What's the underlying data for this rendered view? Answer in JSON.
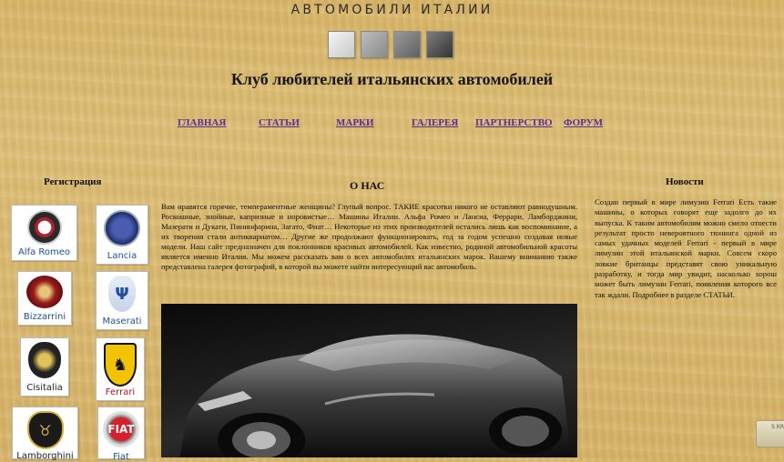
{
  "header": {
    "site_title": "АВТОМОБИЛИ ИТАЛИИ",
    "club_heading": "Клуб любителей итальянских автомобилей"
  },
  "nav": {
    "items": [
      {
        "label": "ГЛАВНАЯ"
      },
      {
        "label": "СТАТЬИ"
      },
      {
        "label": "МАРКИ"
      },
      {
        "label": "ГАЛЕРЕЯ"
      },
      {
        "label": "ПАРТНЕРСТВО"
      },
      {
        "label": "ФОРУМ"
      }
    ],
    "link_color": "#5a2d91"
  },
  "left": {
    "title": "Регистрация",
    "logos": [
      {
        "name": "Alfa Romeo",
        "icon": "alfa-romeo-icon",
        "color": "#b41e2a"
      },
      {
        "name": "Lancia",
        "icon": "lancia-icon",
        "color": "#2a3d8f"
      },
      {
        "name": "Bizzarrini",
        "icon": "bizzarrini-icon",
        "color": "#9b1b1b"
      },
      {
        "name": "Maserati",
        "icon": "maserati-icon",
        "color": "#1e4fa0"
      },
      {
        "name": "Cisitalia",
        "icon": "cisitalia-icon",
        "color": "#222222"
      },
      {
        "name": "Ferrari",
        "icon": "ferrari-icon",
        "color": "#f3c300"
      },
      {
        "name": "Lamborghini",
        "icon": "lamborghini-icon",
        "color": "#1a1a1a"
      },
      {
        "name": "Fiat",
        "icon": "fiat-icon",
        "color": "#b8121b"
      }
    ]
  },
  "center": {
    "title": "О НАС",
    "text": "Вам нравятся горячие, темпераментные женщины? Глупый вопрос. ТАКИЕ красотки никого не оставляют равнодушным. Роскошные, знойные, капризные и норовистые… Машины Италии. Альфа Ромео и Лансиа, Феррари, Ламборджини, Мазерати и Дукати, Пининфарина, Загато, Фиат… Некоторые из этих производителей остались лишь как воспоминание, а их творения стали антиквариатом… Другие же продолжают функционировать, год за годом успешно создавая новые модели. Наш сайт предназначен для поклонников красивых автомобилей. Как известно, родиной автомобильной красоты является именно Италия. Мы можем рассказать вам о всех автомобилях итальянских марок. Вашему вниманию также представлена галерея фотографий, в которой вы можете найти интересующий вас автомобиль."
  },
  "right": {
    "title": "Новости",
    "text": "Создан первый в мире лимузин Ferrari Есть такие машины, о которых говорят еще задолго до их выпуска. К таким автомобилям можно смело отнести результат просто невероятного тюнинга одной из самых удачных моделей Ferrari - первый в мире лимузин этой итальянской марки. Совсем скоро ловкие британцы представят свою уникальную разработку, и тогда мир увидит, насколько хорош может быть лимузин Ferrari, появления которого все так ждали. Подробнее в разделе СТАТЬИ."
  },
  "corner_badge": {
    "text": "S KR"
  }
}
